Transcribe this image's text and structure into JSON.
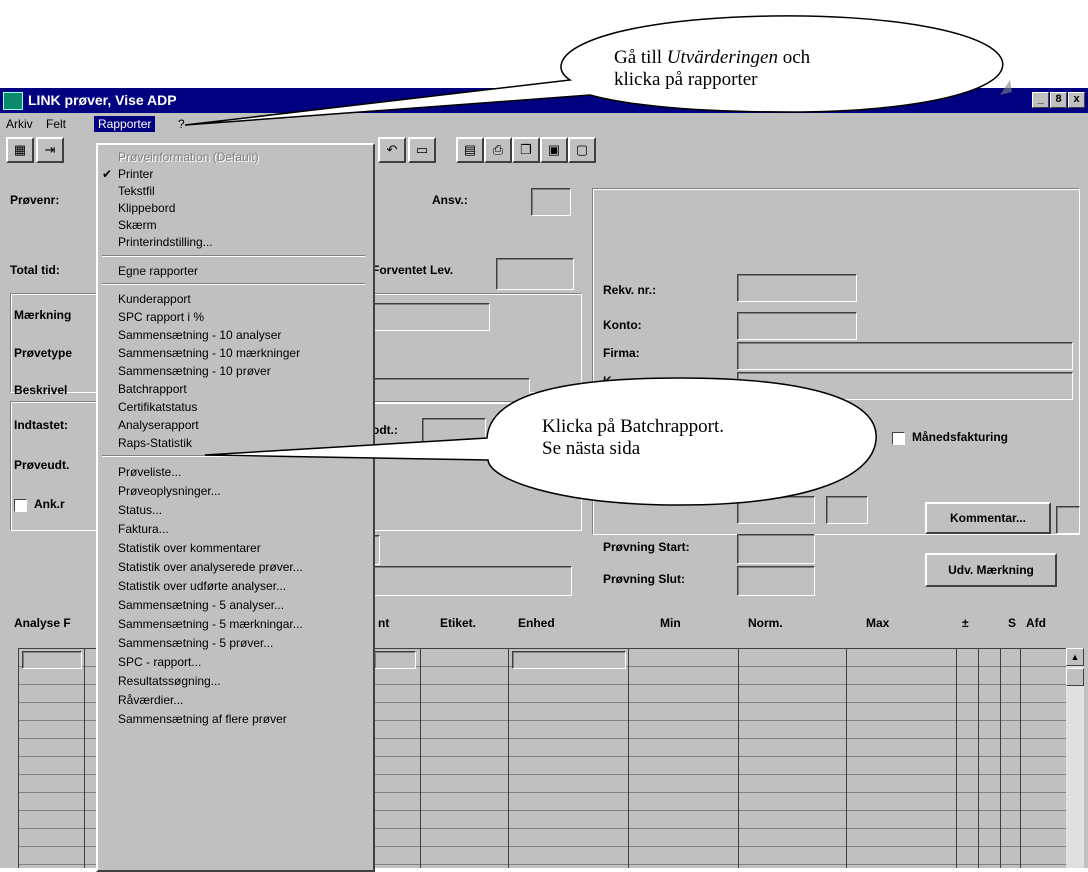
{
  "window": {
    "title": "LINK prøver, Vise ADP",
    "controls": [
      "_",
      "8",
      "x"
    ]
  },
  "menubar": {
    "items": [
      "Arkiv",
      "Felt",
      "Rapporter",
      "?"
    ]
  },
  "form": {
    "provenr_label": "Prøvenr:",
    "ansv_label": "Ansv.:",
    "total_tid_label": "Total tid:",
    "forventet_label": "Forventet Lev.",
    "rekv_label": "Rekv. nr.:",
    "maerkning_label": "Mærkning",
    "konto_label": "Konto:",
    "provetype_label": "Prøvetype",
    "firma_label": "Firma:",
    "beskrivelse_label": "Beskrivel",
    "k_label": "K",
    "indtastet_label": "Indtastet:",
    "modt_label": "odt.:",
    "manedsfakturing_label": "Månedsfakturing",
    "proveudt_label": "Prøveudt.",
    "ank_label": "Ank.r",
    "kommentar_button": "Kommentar...",
    "provning_start_label": "Prøvning Start:",
    "provning_slut_label": "Prøvning Slut:",
    "udv_button": "Udv. Mærkning"
  },
  "grid": {
    "headers": [
      "Analyse F",
      "nt",
      "Etiket.",
      "Enhed",
      "Min",
      "Norm.",
      "Max",
      "±",
      "S",
      "Afd"
    ]
  },
  "dropdown": {
    "items": [
      "Prøveinformation (Default)",
      "Printer",
      "Tekstfil",
      "Klippebord",
      "Skærm",
      "Printerindstilling...",
      "Egne rapporter",
      "Kunderapport",
      "SPC rapport i %",
      "Sammensætning - 10 analyser",
      "Sammensætning - 10 mærkninger",
      "Sammensætning - 10 prøver",
      "Batchrapport",
      "Certifikatstatus",
      "Analyserapport",
      "Raps-Statistik",
      "Prøveliste...",
      "Prøveoplysninger...",
      "Status...",
      "Faktura...",
      "Statistik over kommentarer",
      "Statistik over analyserede prøver...",
      "Statistik over udførte analyser...",
      "Sammensætning - 5 analyser...",
      "Sammensætning - 5 mærkningar...",
      "Sammensætning - 5 prøver...",
      "SPC - rapport...",
      "Resultatssøgning...",
      "Råværdier...",
      "Sammensætning af flere prøver"
    ],
    "checkmark": "✔"
  },
  "callouts": {
    "top_line1_pre": "Gå till ",
    "top_line1_em": "Utvärderingen",
    "top_line1_post": " och",
    "top_line2": "klicka på rapporter",
    "mid_line1": "Klicka på Batchrapport.",
    "mid_line2": "Se nästa sida"
  }
}
